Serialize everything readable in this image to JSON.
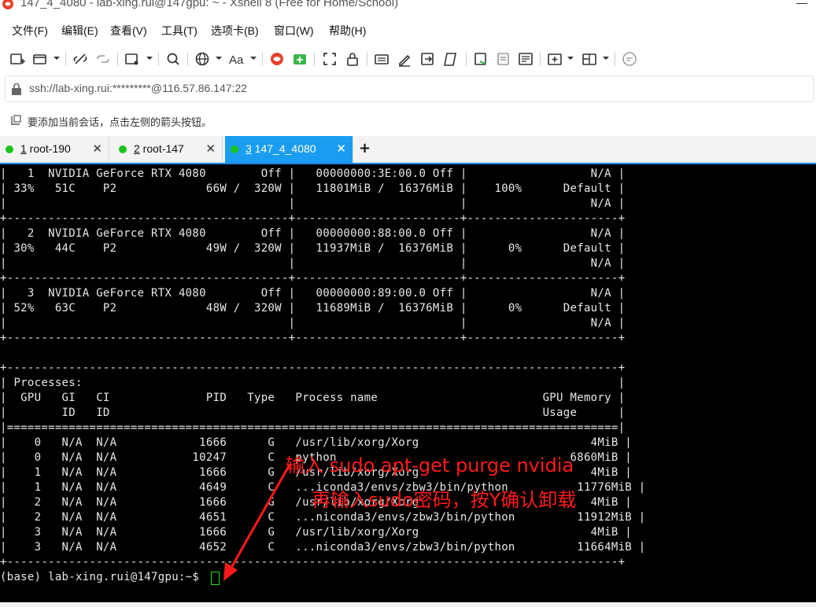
{
  "window": {
    "title": "147_4_4080 - lab-xing.rui@147gpu: ~ - Xshell 8 (Free for Home/School)"
  },
  "menu": [
    "文件(F)",
    "编辑(E)",
    "查看(V)",
    "工具(T)",
    "选项卡(B)",
    "窗口(W)",
    "帮助(H)"
  ],
  "toolbar": {
    "icons": [
      "new-session-icon",
      "open-folder-icon",
      "disconnect-icon",
      "reconnect-icon",
      "new-window-icon",
      "search-icon",
      "globe-icon",
      "font-icon",
      "xshell-logo-icon",
      "xftp-icon",
      "fullscreen-icon",
      "lock-icon",
      "keyboard-icon",
      "pen-icon",
      "export-icon",
      "script-icon",
      "compose-icon",
      "compose-bar-icon",
      "log-icon",
      "new-tab-icon",
      "layout-icon",
      "chat-icon"
    ]
  },
  "address": {
    "text": "ssh://lab-xing.rui:*********@116.57.86.147:22"
  },
  "hint": {
    "text": "要添加当前会话，点击左侧的箭头按钮。"
  },
  "tabs": [
    {
      "num": "1",
      "label": " root-190",
      "status_color": "#1ac41a",
      "active": false
    },
    {
      "num": "2",
      "label": " root-147",
      "status_color": "#1ac41a",
      "active": false
    },
    {
      "num": "3",
      "label": " 147_4_4080",
      "status_color": "#1ac41a",
      "active": true
    }
  ],
  "terminal": {
    "lines": [
      "|   1  NVIDIA GeForce RTX 4080        Off |   00000000:3E:00.0 Off |                  N/A |",
      "| 33%   51C    P2             66W /  320W |   11801MiB /  16376MiB |    100%      Default |",
      "|                                         |                        |                  N/A |",
      "+-----------------------------------------+------------------------+----------------------+",
      "|   2  NVIDIA GeForce RTX 4080        Off |   00000000:88:00.0 Off |                  N/A |",
      "| 30%   44C    P2             49W /  320W |   11937MiB /  16376MiB |      0%      Default |",
      "|                                         |                        |                  N/A |",
      "+-----------------------------------------+------------------------+----------------------+",
      "|   3  NVIDIA GeForce RTX 4080        Off |   00000000:89:00.0 Off |                  N/A |",
      "| 52%   63C    P2             48W /  320W |   11689MiB /  16376MiB |      0%      Default |",
      "|                                         |                        |                  N/A |",
      "+-----------------------------------------+------------------------+----------------------+",
      "",
      "+-----------------------------------------------------------------------------------------+",
      "| Processes:                                                                              |",
      "|  GPU   GI   CI              PID   Type   Process name                        GPU Memory |",
      "|        ID   ID                                                               Usage      |",
      "|=========================================================================================|",
      "|    0   N/A  N/A            1666      G   /usr/lib/xorg/Xorg                         4MiB |",
      "|    0   N/A  N/A           10247      C   python                                  6860MiB |",
      "|    1   N/A  N/A            1666      G   /usr/lib/xorg/Xorg                         4MiB |",
      "|    1   N/A  N/A            4649      C   ...iconda3/envs/zbw3/bin/python          11776MiB |",
      "|    2   N/A  N/A            1666      G   /usr/lib/xorg/Xorg                         4MiB |",
      "|    2   N/A  N/A            4651      C   ...niconda3/envs/zbw3/bin/python         11912MiB |",
      "|    3   N/A  N/A            1666      G   /usr/lib/xorg/Xorg                         4MiB |",
      "|    3   N/A  N/A            4652      C   ...niconda3/envs/zbw3/bin/python         11664MiB |",
      "+-----------------------------------------------------------------------------------------+",
      "(base) lab-xing.rui@147gpu:~$ "
    ]
  },
  "annotations": {
    "line1": "输入 sudo apt-get purge nvidia",
    "line2": "再输入sudo密码，按Y确认卸载",
    "color": "#ff1a1a"
  }
}
